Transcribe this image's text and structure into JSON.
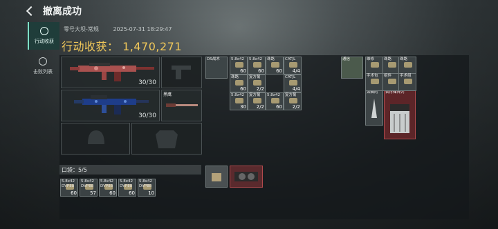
{
  "header": {
    "title": "撤离成功"
  },
  "sidebar": {
    "tabs": [
      {
        "label": "行动收获",
        "active": true
      },
      {
        "label": "击败列表",
        "active": false
      }
    ]
  },
  "meta": {
    "map": "零号大坝-常规",
    "time": "2025-07-31 18:29:47"
  },
  "haul": {
    "label": "行动收获：",
    "value": "1,470,271"
  },
  "weapons": [
    {
      "ammo": "30/30"
    },
    {
      "ammo": "30/30"
    }
  ],
  "melee": {
    "label": "黑鹰"
  },
  "pouch": {
    "label": "口袋：",
    "value": "5/5"
  },
  "pouch_items": [
    {
      "name": "5.8x42",
      "sub": "DVP88",
      "count": "60"
    },
    {
      "name": "5.8x42",
      "sub": "DVP88",
      "count": "57"
    },
    {
      "name": "5.8x42",
      "sub": "DVP88",
      "count": "60"
    },
    {
      "name": "5.8x42",
      "sub": "DVP88",
      "count": "60"
    },
    {
      "name": "5.8x42",
      "sub": "DVP88",
      "count": "10"
    }
  ],
  "rig_items": [
    {
      "name": "DS战术",
      "count": ""
    },
    {
      "name": "5.8x42",
      "count": "60"
    },
    {
      "name": "5.8x42",
      "count": "60"
    },
    {
      "name": "珠路",
      "count": "60"
    },
    {
      "name": "CATJL",
      "count": "4/4"
    },
    {
      "name": "珠路",
      "count": "60"
    },
    {
      "name": "复方葡",
      "count": "2/2"
    },
    {
      "name": "CATJL",
      "count": "4/4"
    },
    {
      "name": "5.8x42",
      "count": "30"
    },
    {
      "name": "复方葡",
      "count": "2/2"
    },
    {
      "name": "5.8x42",
      "count": "60"
    },
    {
      "name": "复方葡",
      "count": "2/2"
    }
  ],
  "backpack_items": [
    {
      "name": "通信",
      "count": ""
    },
    {
      "name": "维修",
      "count": ""
    },
    {
      "name": "珠路",
      "count": ""
    },
    {
      "name": "珠路",
      "count": ""
    },
    {
      "name": "手术包",
      "count": ""
    },
    {
      "name": "组件",
      "count": ""
    },
    {
      "name": "手术组",
      "count": ""
    },
    {
      "name": "如舞的",
      "count": ""
    },
    {
      "name": "云存储阵列",
      "count": ""
    }
  ],
  "colors": {
    "accent": "#7ee0c7",
    "gold": "#f1c85a",
    "red": "#8a2f33"
  }
}
